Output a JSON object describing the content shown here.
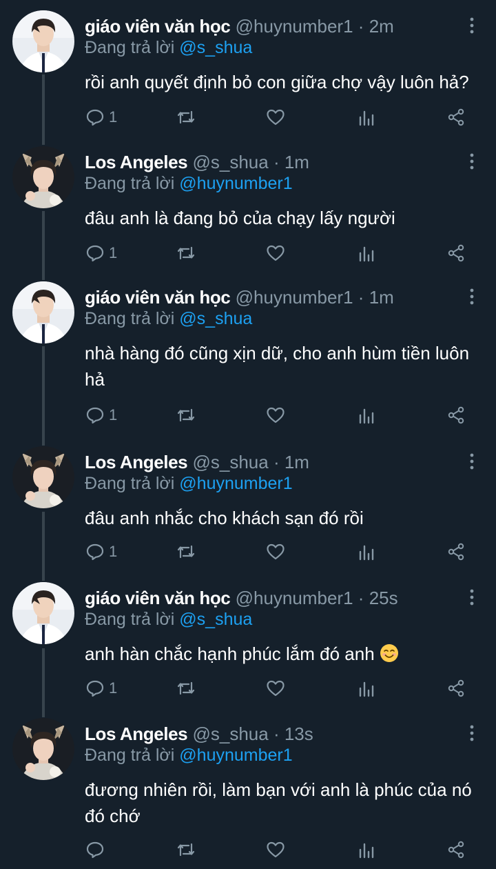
{
  "theme": {
    "background": "#15202b",
    "secondary_text": "#8899a6",
    "link": "#1da1f2",
    "thread_line": "#38444d"
  },
  "tweets": [
    {
      "name": "giáo viên văn học",
      "handle": "@huynumber1",
      "separator": "·",
      "time": "2m",
      "reply_prefix": "Đang trả lời",
      "reply_to": "@s_shua",
      "text": "rồi anh quyết định bỏ con giữa chợ vậy luôn hả?",
      "reply_count": "1",
      "avatar": "avatar-giao-vien"
    },
    {
      "name": "Los Angeles",
      "handle": "@s_shua",
      "separator": "·",
      "time": "1m",
      "reply_prefix": "Đang trả lời",
      "reply_to": "@huynumber1",
      "text": "đâu anh là đang bỏ của chạy lấy người",
      "reply_count": "1",
      "avatar": "avatar-los-angeles"
    },
    {
      "name": "giáo viên văn học",
      "handle": "@huynumber1",
      "separator": "·",
      "time": "1m",
      "reply_prefix": "Đang trả lời",
      "reply_to": "@s_shua",
      "text": "nhà hàng đó cũng xịn dữ, cho anh hùm tiền luôn hả",
      "reply_count": "1",
      "avatar": "avatar-giao-vien"
    },
    {
      "name": "Los Angeles",
      "handle": "@s_shua",
      "separator": "·",
      "time": "1m",
      "reply_prefix": "Đang trả lời",
      "reply_to": "@huynumber1",
      "text": "đâu anh nhắc cho khách sạn đó rồi",
      "reply_count": "1",
      "avatar": "avatar-los-angeles"
    },
    {
      "name": "giáo viên văn học",
      "handle": "@huynumber1",
      "separator": "·",
      "time": "25s",
      "reply_prefix": "Đang trả lời",
      "reply_to": "@s_shua",
      "text": "anh hàn chắc hạnh phúc lắm đó anh",
      "text_emoji": "smiling-face-emoji",
      "reply_count": "1",
      "avatar": "avatar-giao-vien"
    },
    {
      "name": "Los Angeles",
      "handle": "@s_shua",
      "separator": "·",
      "time": "13s",
      "reply_prefix": "Đang trả lời",
      "reply_to": "@huynumber1",
      "text": "đương nhiên rồi, làm bạn với anh là phúc của nó đó chớ",
      "reply_count": "",
      "avatar": "avatar-los-angeles"
    }
  ],
  "icons": {
    "reply": "reply-icon",
    "retweet": "retweet-icon",
    "like": "heart-icon",
    "analytics": "analytics-icon",
    "share": "share-icon",
    "more": "more-vertical-icon"
  }
}
